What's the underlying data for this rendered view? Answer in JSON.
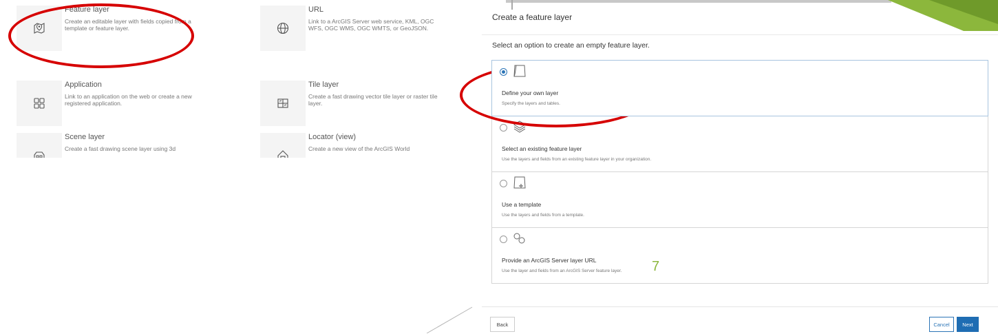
{
  "gallery": {
    "items": [
      {
        "title": "Feature layer",
        "description": "Create an editable layer with fields copied from a template or feature layer.",
        "icon": "feature-layer-icon"
      },
      {
        "title": "URL",
        "description": "Link to a ArcGIS Server web service, KML, OGC WFS, OGC WMS, OGC WMTS, or GeoJSON.",
        "icon": "globe-icon"
      },
      {
        "title": "Application",
        "description": "Link to an application on the web or create a new registered application.",
        "icon": "app-grid-icon"
      },
      {
        "title": "Tile layer",
        "description": "Create a fast drawing vector tile layer or raster tile layer.",
        "icon": "tile-layer-icon"
      },
      {
        "title": "Scene layer",
        "description": "Create a fast drawing scene layer using 3d",
        "icon": "scene-layer-icon"
      },
      {
        "title": "Locator (view)",
        "description": "Create a new view of the ArcGIS World",
        "icon": "locator-icon"
      }
    ]
  },
  "dialog": {
    "title": "Create a feature layer",
    "close_label": "×",
    "prompt": "Select an option to create an empty feature layer.",
    "options": [
      {
        "title": "Define your own layer",
        "description": "Specify the layers and tables.",
        "selected": true,
        "icon": "define-layer-icon"
      },
      {
        "title": "Select an existing feature layer",
        "description": "Use the layers and fields from an existing feature layer in your organization.",
        "selected": false,
        "icon": "layers-stack-icon"
      },
      {
        "title": "Use a template",
        "description": "Use the layers and fields from a template.",
        "selected": false,
        "icon": "template-add-icon"
      },
      {
        "title": "Provide an ArcGIS Server layer URL",
        "description": "Use the layer and fields from an ArcGIS Server feature layer.",
        "selected": false,
        "icon": "link-icon"
      }
    ],
    "back_label": "Back",
    "cancel_label": "Cancel",
    "next_label": "Next"
  },
  "page_number": "7",
  "colors": {
    "highlight_ring": "#d60000",
    "accent": "#1f6db3",
    "slide_green": "#8cb73c"
  }
}
